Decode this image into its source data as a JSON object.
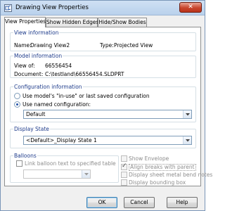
{
  "window": {
    "title": "Drawing View Properties",
    "close_glyph": "✕"
  },
  "tabs": [
    {
      "label": "View Properties"
    },
    {
      "label": "Show Hidden Edges"
    },
    {
      "label": "Hide/Show Bodies"
    }
  ],
  "view_information": {
    "heading": "View information",
    "name_label": "Name:",
    "name_value": "Drawing View2",
    "type_label": "Type:",
    "type_value": "Projected View"
  },
  "model_information": {
    "heading": "Model information",
    "view_of_label": "View of:",
    "view_of_value": "66556454",
    "document_label": "Document:",
    "document_value": "C:\\testland\\66556454.SLDPRT"
  },
  "configuration_information": {
    "heading": "Configuration information",
    "option_in_use": "Use model's \"in-use\" or last saved configuration",
    "option_named": "Use named configuration:",
    "selected_option": "named",
    "named_configuration": "Default"
  },
  "display_state": {
    "heading": "Display State",
    "selected": "<Default>_Display State 1"
  },
  "balloons": {
    "heading": "Balloons",
    "link_text_label": "Link balloon text to specified table",
    "link_text_checked": false,
    "table_select_value": ""
  },
  "options": {
    "show_envelope": {
      "label": "Show Envelope",
      "checked": false,
      "enabled": false
    },
    "align_breaks": {
      "label": "Align breaks with parent",
      "checked": true,
      "enabled": false
    },
    "sheet_metal_bend_notes": {
      "label": "Display sheet metal bend notes",
      "checked": false,
      "enabled": false
    },
    "bounding_box": {
      "label": "Display bounding box",
      "checked": false,
      "enabled": false
    }
  },
  "buttons": {
    "ok": "OK",
    "cancel": "Cancel",
    "help": "Help"
  },
  "colors": {
    "group_heading": "#1c3a8a",
    "title_bar": "#b9d1ec",
    "close_button": "#c8452c"
  },
  "icons": {
    "app": "drawing-view-icon",
    "dropdown": "chevron-down-icon"
  }
}
